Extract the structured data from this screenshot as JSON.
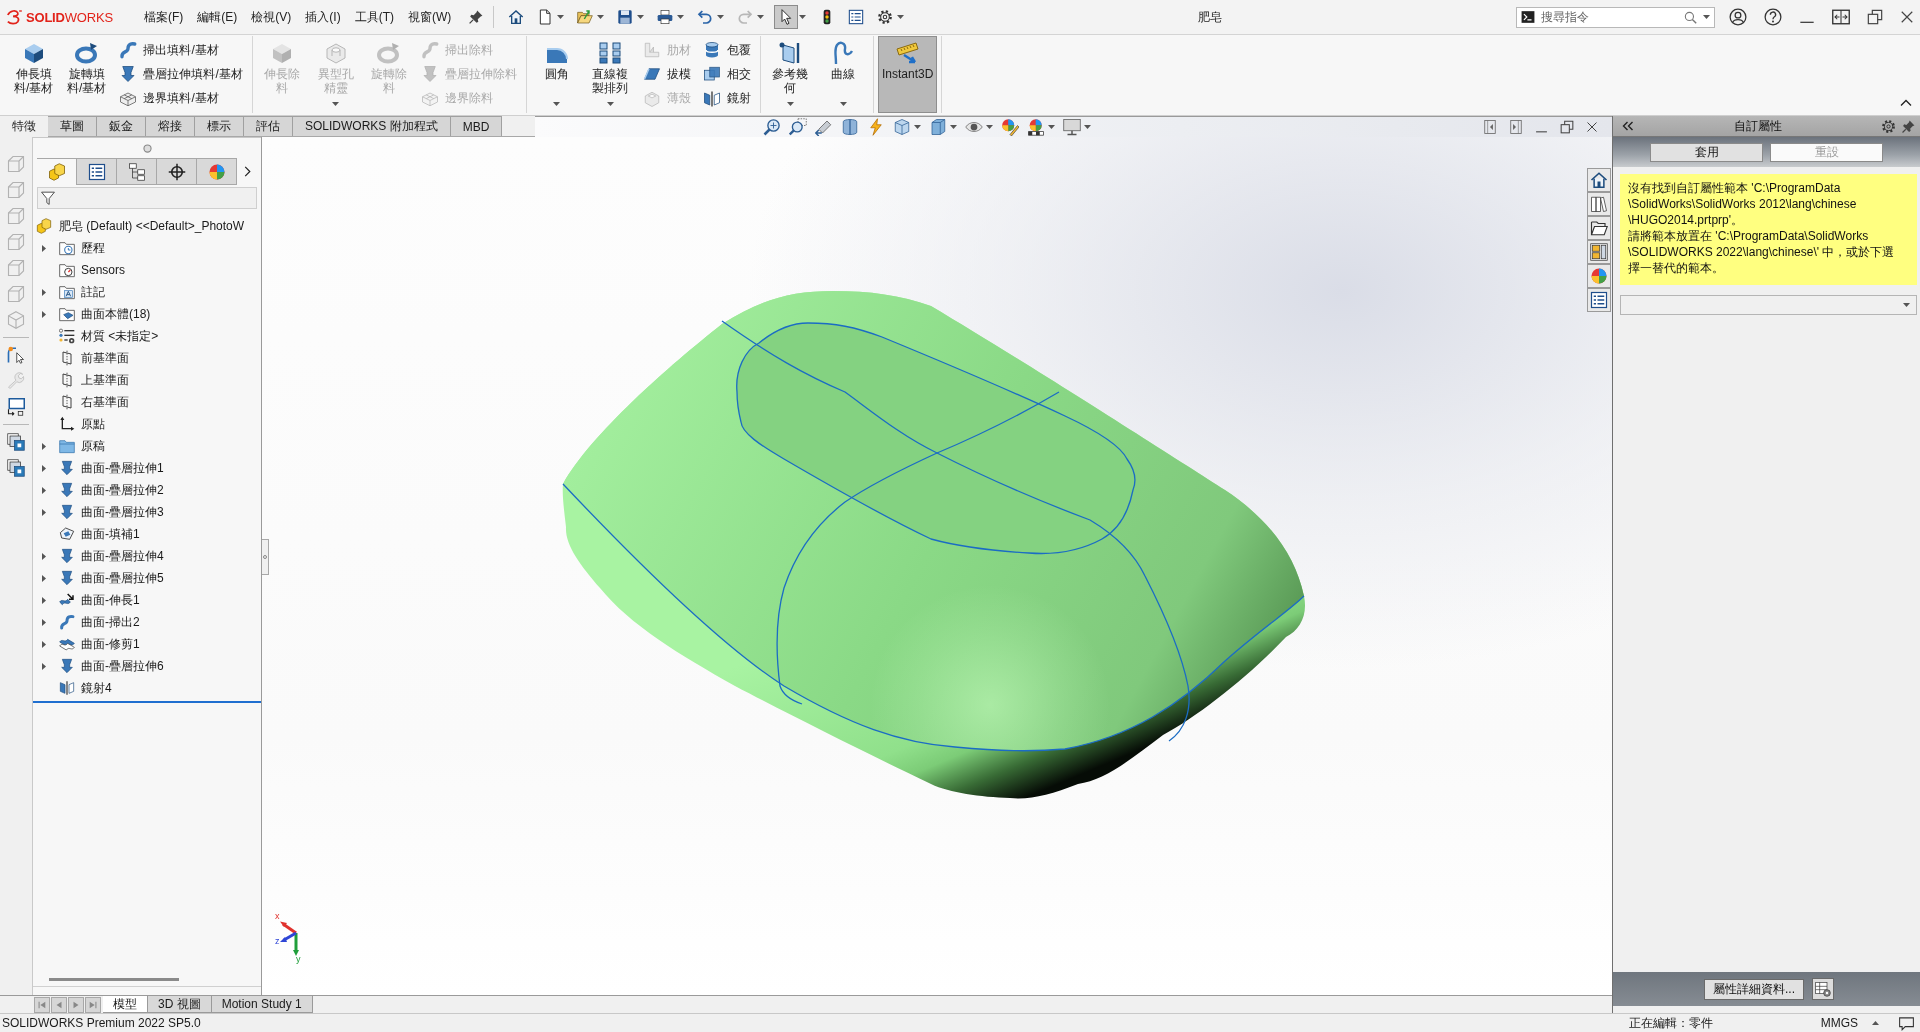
{
  "app_bar": {
    "logo": "**SOLID**WORKS",
    "menus": [
      "檔案(F)",
      "編輯(E)",
      "檢視(V)",
      "插入(I)",
      "工具(T)",
      "視窗(W)"
    ],
    "quick_tools": [
      {
        "kind": "home",
        "dropdown": false,
        "disabled": false,
        "selected": false
      },
      {
        "kind": "new",
        "dropdown": true,
        "disabled": false,
        "selected": false
      },
      {
        "kind": "open",
        "dropdown": true,
        "disabled": false,
        "selected": false
      },
      {
        "kind": "save",
        "dropdown": true,
        "disabled": false,
        "selected": false
      },
      {
        "kind": "print",
        "dropdown": true,
        "disabled": false,
        "selected": false
      },
      {
        "kind": "undo",
        "dropdown": true,
        "disabled": false,
        "selected": false
      },
      {
        "kind": "redo",
        "dropdown": true,
        "disabled": true,
        "selected": false
      },
      {
        "kind": "select",
        "dropdown": true,
        "disabled": false,
        "selected": true
      },
      {
        "kind": "rebuild",
        "dropdown": false,
        "disabled": false,
        "selected": false
      },
      {
        "kind": "list",
        "dropdown": false,
        "disabled": false,
        "selected": false
      },
      {
        "kind": "options",
        "dropdown": true,
        "disabled": false,
        "selected": false
      }
    ],
    "title": "肥皂",
    "search": {
      "placeholder": "搜尋指令"
    }
  },
  "command_manager": {
    "groups": [
      {
        "columns": [
          {
            "kind": "large",
            "tool": {
              "kind": "extrude",
              "label": "伸長填料/基材",
              "disabled": false,
              "dropdown": false,
              "pressed": false
            }
          },
          {
            "kind": "large",
            "tool": {
              "kind": "revolve",
              "label": "旋轉填料/基材",
              "disabled": false,
              "dropdown": false,
              "pressed": false
            }
          },
          {
            "kind": "stack",
            "tools": [
              {
                "kind": "sweep",
                "label": "掃出填料/基材",
                "disabled": false
              },
              {
                "kind": "loft",
                "label": "疊層拉伸填料/基材",
                "disabled": false
              },
              {
                "kind": "boundary",
                "label": "邊界填料/基材",
                "disabled": false
              }
            ]
          }
        ]
      },
      {
        "columns": [
          {
            "kind": "large",
            "tool": {
              "kind": "extrude",
              "label": "伸長除料",
              "disabled": true,
              "dropdown": false,
              "pressed": false
            }
          },
          {
            "kind": "large",
            "tool": {
              "kind": "hole",
              "label": "異型孔精靈",
              "disabled": true,
              "dropdown": true,
              "pressed": false
            }
          },
          {
            "kind": "large",
            "tool": {
              "kind": "revolve",
              "label": "旋轉除料",
              "disabled": true,
              "dropdown": false,
              "pressed": false
            }
          },
          {
            "kind": "stack",
            "tools": [
              {
                "kind": "sweep",
                "label": "掃出除料",
                "disabled": true
              },
              {
                "kind": "loft",
                "label": "疊層拉伸除料",
                "disabled": true
              },
              {
                "kind": "boundary",
                "label": "邊界除料",
                "disabled": true
              }
            ]
          }
        ]
      },
      {
        "columns": [
          {
            "kind": "large",
            "tool": {
              "kind": "fillet",
              "label": "圓角",
              "disabled": false,
              "dropdown": true,
              "pressed": false
            }
          },
          {
            "kind": "large",
            "tool": {
              "kind": "pattern",
              "label": "直線複製排列",
              "disabled": false,
              "dropdown": true,
              "pressed": false
            }
          },
          {
            "kind": "stack",
            "tools": [
              {
                "kind": "rib",
                "label": "肋材",
                "disabled": true
              },
              {
                "kind": "draft",
                "label": "拔模",
                "disabled": false
              },
              {
                "kind": "shell",
                "label": "薄殼",
                "disabled": true
              }
            ]
          },
          {
            "kind": "stack",
            "tools": [
              {
                "kind": "wrap",
                "label": "包覆",
                "disabled": false
              },
              {
                "kind": "intersect",
                "label": "相交",
                "disabled": false
              },
              {
                "kind": "mirror",
                "label": "鏡射",
                "disabled": false
              }
            ]
          }
        ]
      },
      {
        "columns": [
          {
            "kind": "large",
            "tool": {
              "kind": "refgeom",
              "label": "參考幾何",
              "disabled": false,
              "dropdown": true,
              "pressed": false
            }
          },
          {
            "kind": "large",
            "tool": {
              "kind": "curves",
              "label": "曲線",
              "disabled": false,
              "dropdown": true,
              "pressed": false
            }
          }
        ]
      },
      {
        "columns": [
          {
            "kind": "large",
            "tool": {
              "kind": "instant3d",
              "label": "Instant3D",
              "disabled": false,
              "dropdown": false,
              "pressed": true
            }
          }
        ]
      }
    ]
  },
  "command_tabs": [
    {
      "label": "特徵",
      "selected": true
    },
    {
      "label": "草圖",
      "selected": false
    },
    {
      "label": "鈑金",
      "selected": false
    },
    {
      "label": "熔接",
      "selected": false
    },
    {
      "label": "標示",
      "selected": false
    },
    {
      "label": "評估",
      "selected": false
    },
    {
      "label": "SOLIDWORKS 附加程式",
      "selected": false
    },
    {
      "label": "MBD",
      "selected": false
    }
  ],
  "side_tools": [
    [
      {
        "kind": "cube",
        "disabled": true
      },
      {
        "kind": "cube",
        "disabled": true
      },
      {
        "kind": "cube",
        "disabled": true
      },
      {
        "kind": "cube",
        "disabled": true
      },
      {
        "kind": "cube",
        "disabled": true
      },
      {
        "kind": "cube",
        "disabled": true
      },
      {
        "kind": "iso-cube",
        "disabled": true
      }
    ],
    [
      {
        "kind": "select-box",
        "disabled": false
      },
      {
        "kind": "wrench",
        "disabled": true
      },
      {
        "kind": "screen",
        "disabled": false
      }
    ],
    [
      {
        "kind": "windows",
        "disabled": false
      },
      {
        "kind": "windows",
        "disabled": false
      }
    ]
  ],
  "feature_manager": {
    "tabs": [
      {
        "kind": "part",
        "selected": true
      },
      {
        "kind": "list",
        "selected": false
      },
      {
        "kind": "configurations",
        "selected": false
      },
      {
        "kind": "crosshair",
        "selected": false
      },
      {
        "kind": "color-ball",
        "selected": false
      }
    ],
    "root": "肥皂 (Default) <<Default>_PhotoW",
    "items": [
      {
        "kind": "history",
        "label": "歷程",
        "expandable": true
      },
      {
        "kind": "sensors",
        "label": "Sensors",
        "expandable": false
      },
      {
        "kind": "annotations",
        "label": "註記",
        "expandable": true
      },
      {
        "kind": "bodies",
        "label": "曲面本體(18)",
        "expandable": true
      },
      {
        "kind": "material",
        "label": "材質 <未指定>",
        "expandable": false
      },
      {
        "kind": "plane",
        "label": "前基準面",
        "expandable": false
      },
      {
        "kind": "plane",
        "label": "上基準面",
        "expandable": false
      },
      {
        "kind": "plane",
        "label": "右基準面",
        "expandable": false
      },
      {
        "kind": "origin",
        "label": "原點",
        "expandable": false
      },
      {
        "kind": "folder",
        "label": "原稿",
        "expandable": true
      },
      {
        "kind": "loft",
        "label": "曲面-疊層拉伸1",
        "expandable": true
      },
      {
        "kind": "loft",
        "label": "曲面-疊層拉伸2",
        "expandable": true
      },
      {
        "kind": "loft",
        "label": "曲面-疊層拉伸3",
        "expandable": true
      },
      {
        "kind": "fill",
        "label": "曲面-填補1",
        "expandable": false
      },
      {
        "kind": "loft",
        "label": "曲面-疊層拉伸4",
        "expandable": true
      },
      {
        "kind": "loft",
        "label": "曲面-疊層拉伸5",
        "expandable": true
      },
      {
        "kind": "extend",
        "label": "曲面-伸長1",
        "expandable": true
      },
      {
        "kind": "sweep",
        "label": "曲面-掃出2",
        "expandable": true
      },
      {
        "kind": "trim",
        "label": "曲面-修剪1",
        "expandable": true
      },
      {
        "kind": "loft",
        "label": "曲面-疊層拉伸6",
        "expandable": true
      },
      {
        "kind": "mirror",
        "label": "鏡射4",
        "expandable": false
      }
    ]
  },
  "graphics": {
    "triad": [
      {
        "label": "x",
        "color": "#e0322d"
      },
      {
        "label": "y",
        "color": "#1f9e3a"
      },
      {
        "label": "z",
        "color": "#2e45d6"
      }
    ]
  },
  "bottom_tabs": [
    {
      "label": "模型",
      "selected": true
    },
    {
      "label": "3D 視圖",
      "selected": false
    },
    {
      "label": "Motion Study 1",
      "selected": false
    }
  ],
  "task_pane": {
    "title": "自訂屬性",
    "buttons": [
      {
        "label": "套用",
        "disabled": false
      },
      {
        "label": "重設",
        "disabled": true
      }
    ],
    "note": [
      "沒有找到自訂屬性範本 'C:\\ProgramData\\SolidWorks\\SolidWorks 2012\\lang\\chinese\\HUGO2014.prtprp'。",
      "請將範本放置在 'C:\\ProgramData\\SolidWorks\\SOLIDWORKS 2022\\lang\\chinese\\' 中，或於下選擇一替代的範本。"
    ],
    "details_button": "屬性詳細資料..."
  },
  "status_bar": {
    "version": "SOLIDWORKS Premium 2022 SP5.0",
    "mode": "正在編輯：零件",
    "units": "MMGS"
  }
}
